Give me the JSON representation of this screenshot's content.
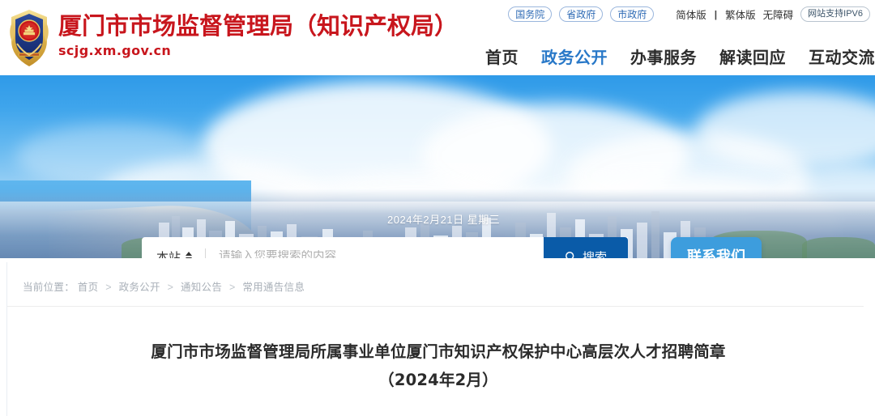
{
  "header": {
    "emblem_icon": "national-emblem-badge-icon",
    "site_title": "厦门市市场监督管理局（知识产权局）",
    "site_domain": "scjg.xm.gov.cn",
    "top_links": {
      "gov_pills": [
        "国务院",
        "省政府",
        "市政府"
      ],
      "simplified": "简体版",
      "divider": "|",
      "traditional": "繁体版",
      "accessibility": "无障碍",
      "ipv6": "网站支持IPV6"
    },
    "nav": [
      {
        "label": "首页",
        "active": false
      },
      {
        "label": "政务公开",
        "active": true
      },
      {
        "label": "办事服务",
        "active": false
      },
      {
        "label": "解读回应",
        "active": false
      },
      {
        "label": "互动交流",
        "active": false
      }
    ]
  },
  "banner": {
    "date": "2024年2月21日 星期三",
    "search": {
      "scope_label": "本站",
      "scope_icon": "updown-stepper-icon",
      "placeholder": "请输入您要搜索的内容",
      "value": "",
      "button_label": "搜索",
      "button_icon": "search-icon"
    },
    "contact_button": "联系我们"
  },
  "content": {
    "breadcrumb": {
      "prefix": "当前位置：",
      "items": [
        "首页",
        "政务公开",
        "通知公告",
        "常用通告信息"
      ],
      "separator": ">"
    },
    "article": {
      "title_line1": "厦门市市场监督管理局所属事业单位厦门市知识产权保护中心高层次人才招聘简章",
      "title_line2": "（2024年2月）"
    }
  },
  "colors": {
    "brand_red": "#c8161d",
    "nav_active_blue": "#2878c8",
    "search_button_blue": "#0a5ba8",
    "contact_button_blue": "#3d9ddd",
    "header_strip_blue": "#1676cf"
  }
}
